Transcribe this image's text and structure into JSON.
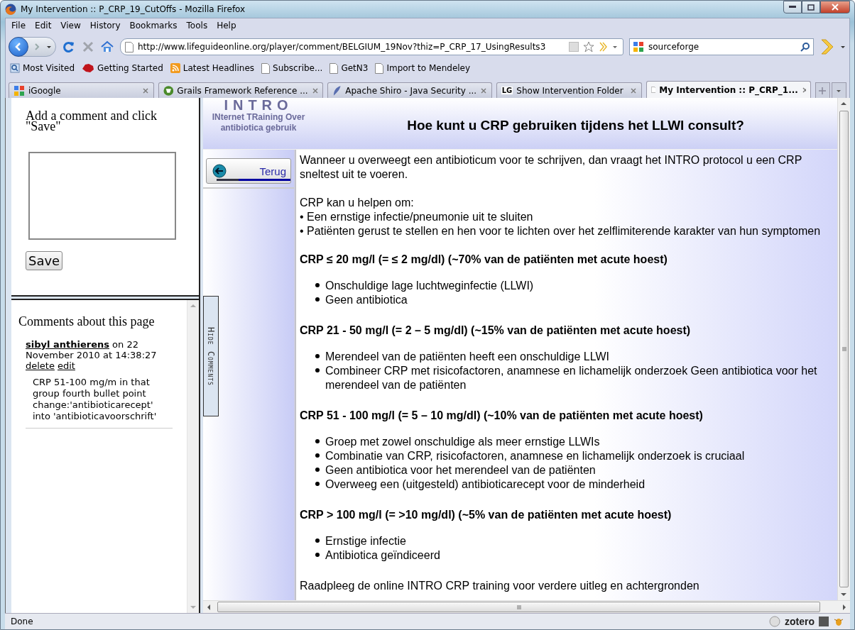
{
  "window": {
    "title": "My Intervention :: P_CRP_19_CutOffs - Mozilla Firefox"
  },
  "menu": [
    "File",
    "Edit",
    "View",
    "History",
    "Bookmarks",
    "Tools",
    "Help"
  ],
  "address": {
    "value": "http://www.lifeguideonline.org/player/comment/BELGIUM_19Nov?thiz=P_CRP_17_UsingResults3"
  },
  "search": {
    "value": "sourceforge"
  },
  "bookmarks": [
    {
      "label": "Most Visited",
      "kind": "search"
    },
    {
      "label": "Getting Started",
      "kind": "animal"
    },
    {
      "label": "Latest Headlines",
      "kind": "feed"
    },
    {
      "label": "Subscribe...",
      "kind": "page"
    },
    {
      "label": "GetN3",
      "kind": "page"
    },
    {
      "label": "Import to Mendeley",
      "kind": "page"
    }
  ],
  "tabs": [
    {
      "label": "iGoogle",
      "selected": false
    },
    {
      "label": "Grails Framework Reference ...",
      "selected": false
    },
    {
      "label": "Apache Shiro - Java Security ...",
      "selected": false
    },
    {
      "label": "Show Intervention Folder",
      "badge": "LG",
      "selected": false
    },
    {
      "label": "My Intervention :: P_CRP_1...",
      "selected": true
    }
  ],
  "comment_form": {
    "prompt": "Add a comment and click \"Save\"",
    "save": "Save"
  },
  "comments": {
    "heading": "Comments about this page",
    "items": [
      {
        "author": "sibyl anthierens",
        "meta": "on 22 November 2010 at 14:38:27",
        "actions": [
          "delete",
          "edit"
        ],
        "text": "CRP 51-100 mg/m in that group fourth bullet point change:'antibioticarecept' into 'antibioticavoorschrift'"
      }
    ]
  },
  "hide_comments": "Hide Comments",
  "header": {
    "logo": "INTRO",
    "logo_sub": "INternet TRaining Over antibiotica gebruik",
    "title": "Hoe kunt u CRP gebruiken tijdens het LLWI consult?"
  },
  "back_button": "Terug",
  "content": [
    {
      "kind": "paragraph",
      "text": "Wanneer u overweegt een antibioticum voor te schrijven, dan vraagt het INTRO protocol u een CRP sneltest uit te voeren."
    },
    {
      "kind": "lines",
      "items": [
        "CRP kan u helpen om:",
        "• Een ernstige infectie/pneumonie uit te sluiten",
        "• Patiënten gerust te stellen en hen voor te lichten over het zelflimiterende karakter van hun symptomen"
      ]
    },
    {
      "kind": "heading",
      "text": "CRP ≤ 20 mg/l (= ≤ 2 mg/dl) (~70% van de patiënten met acute hoest)"
    },
    {
      "kind": "list",
      "items": [
        "Onschuldige lage luchtweginfectie (LLWI)",
        "Geen antibiotica"
      ]
    },
    {
      "kind": "heading",
      "text": "CRP 21 - 50 mg/l (= 2 – 5 mg/dl) (~15% van de patiënten met acute hoest)"
    },
    {
      "kind": "list",
      "items": [
        "Merendeel van de patiënten heeft een onschuldige LLWI",
        "Combineer CRP met risicofactoren, anamnese en lichamelijk onderzoek Geen antibiotica voor het merendeel van de patiënten"
      ]
    },
    {
      "kind": "heading",
      "text": "CRP 51 - 100 mg/l (= 5 – 10 mg/dl) (~10% van de patiënten met acute hoest)"
    },
    {
      "kind": "list",
      "items": [
        "Groep met zowel onschuldige als meer ernstige LLWIs",
        "Combinatie van CRP, risicofactoren, anamnese en lichamelijk onderzoek is cruciaal",
        "Geen antibiotica voor het merendeel van de patiënten",
        "Overweeg een (uitgesteld) antibioticarecept voor de minderheid"
      ]
    },
    {
      "kind": "heading",
      "text": "CRP > 100 mg/l (= >10 mg/dl) (~5% van de patiënten met acute hoest)"
    },
    {
      "kind": "list",
      "items": [
        "Ernstige infectie",
        "Antibiotica geïndiceerd"
      ]
    },
    {
      "kind": "paragraph",
      "text": "Raadpleeg de online INTRO CRP training voor verdere uitleg en achtergronden"
    }
  ],
  "status": {
    "text": "Done",
    "addon": "zotero"
  }
}
